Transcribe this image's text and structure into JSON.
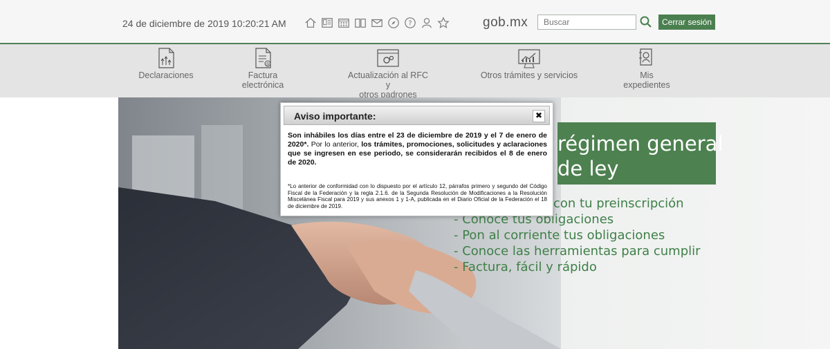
{
  "header": {
    "datetime": "24 de diciembre de 2019 10:20:21 AM",
    "icons": [
      "home-icon",
      "document-icon",
      "calendar-icon",
      "book-icon",
      "mail-icon",
      "compass-icon",
      "help-icon",
      "user-icon",
      "star-icon"
    ],
    "brand": "gob.mx",
    "search_placeholder": "Buscar",
    "logout_label": "Cerrar sesión"
  },
  "nav": {
    "items": [
      {
        "line1": "Declaraciones",
        "line2": ""
      },
      {
        "line1": "Factura",
        "line2": "electrónica"
      },
      {
        "line1": "Actualización al RFC y",
        "line2": "otros padrones"
      },
      {
        "line1": "Otros trámites y servicios",
        "line2": ""
      },
      {
        "line1": "Mis",
        "line2": "expedientes"
      }
    ]
  },
  "hero": {
    "title_line1": "régimen general",
    "title_line2": "de ley",
    "bullets": [
      "con tu preinscripción",
      "- Conoce tus obligaciones",
      "- Pon al corriente tus obligaciones",
      "- Conoce las herramientas para cumplir",
      "- Factura, fácil y rápido"
    ]
  },
  "modal": {
    "title": "Aviso importante:",
    "close": "✖",
    "p1_a": "Son inhábiles los días entre el 23 de diciembre de 2019 y el 7 de enero de 2020*.",
    "p1_b": " Por lo anterior, ",
    "p1_c": "los trámites, promociones, solicitudes y aclaraciones que se ingresen en ese periodo, se considerarán recibidos el 8 de enero de 2020.",
    "note": "*Lo anterior de conformidad con lo dispuesto por el artículo 12, párrafos primero y segundo del Código Fiscal de la Federación y la regla 2.1.6. de la Segunda Resolución de Modificaciones a la Resolución Miscelánea Fiscal para 2019 y sus anexos 1 y 1-A, publicada en el Diario Oficial de la Federación el 18 de diciembre de 2019."
  },
  "colors": {
    "accent": "#4a7f4f",
    "hero_green": "#4d8150",
    "bullet_green": "#3f7f48"
  }
}
